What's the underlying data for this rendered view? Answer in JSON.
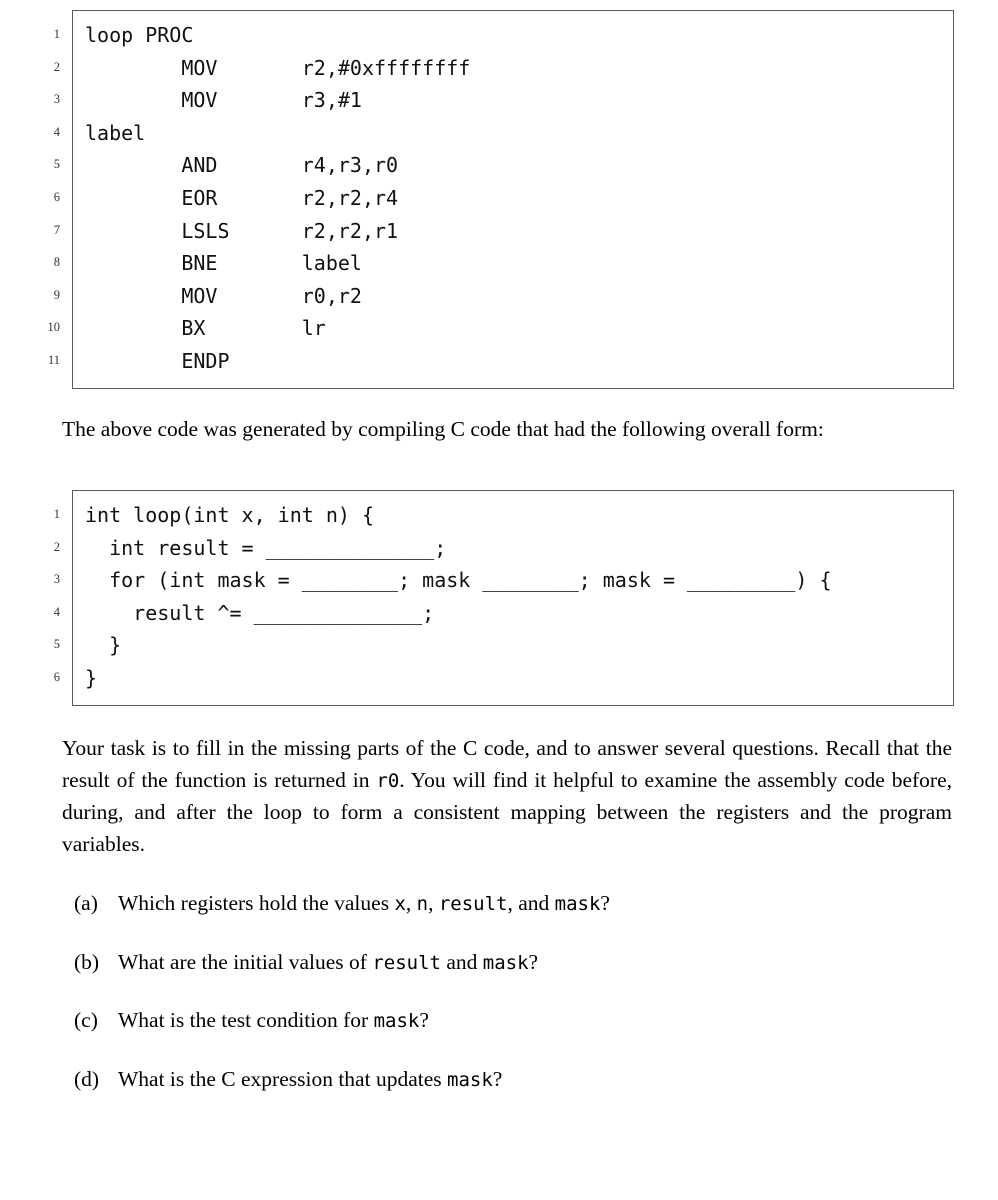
{
  "asm_listing": {
    "name": "arm-assembly-listing",
    "line_numbers": [
      "1",
      "2",
      "3",
      "4",
      "5",
      "6",
      "7",
      "8",
      "9",
      "10",
      "11"
    ],
    "lines": [
      "loop PROC",
      "        MOV       r2,#0xffffffff",
      "        MOV       r3,#1",
      "label",
      "        AND       r4,r3,r0",
      "        EOR       r2,r2,r4",
      "        LSLS      r2,r2,r1",
      "        BNE       label",
      "        MOV       r0,r2",
      "        BX        lr",
      "        ENDP"
    ]
  },
  "intro_paragraph": "The above code was generated by compiling C code that had the following overall form:",
  "c_listing": {
    "name": "c-source-listing",
    "line_numbers": [
      "1",
      "2",
      "3",
      "4",
      "5",
      "6"
    ],
    "lines": [
      "int loop(int x, int n) {",
      "  int result = ______________;",
      "  for (int mask = ________; mask ________; mask = _________) {",
      "    result ^= ______________;",
      "  }",
      "}"
    ]
  },
  "task_paragraph": {
    "part1": "Your task is to fill in the missing parts of the C code, and to answer several questions. Recall that the result of the function is returned in ",
    "mono1": "r0",
    "part2": ". You will find it helpful to examine the assembly code before, during, and after the loop to form a consistent mapping between the registers and the program variables."
  },
  "questions": [
    {
      "label": "(a)",
      "segments": [
        {
          "text": "Which registers hold the values ",
          "mono": false
        },
        {
          "text": "x",
          "mono": true
        },
        {
          "text": ", ",
          "mono": false
        },
        {
          "text": "n",
          "mono": true
        },
        {
          "text": ", ",
          "mono": false
        },
        {
          "text": "result",
          "mono": true
        },
        {
          "text": ", and ",
          "mono": false
        },
        {
          "text": "mask",
          "mono": true
        },
        {
          "text": "?",
          "mono": false
        }
      ],
      "plain": "Which registers hold the values x, n, result, and mask?"
    },
    {
      "label": "(b)",
      "segments": [
        {
          "text": "What are the initial values of ",
          "mono": false
        },
        {
          "text": "result",
          "mono": true
        },
        {
          "text": " and ",
          "mono": false
        },
        {
          "text": "mask",
          "mono": true
        },
        {
          "text": "?",
          "mono": false
        }
      ],
      "plain": "What are the initial values of result and mask?"
    },
    {
      "label": "(c)",
      "segments": [
        {
          "text": "What is the test condition for ",
          "mono": false
        },
        {
          "text": "mask",
          "mono": true
        },
        {
          "text": "?",
          "mono": false
        }
      ],
      "plain": "What is the test condition for mask?"
    },
    {
      "label": "(d)",
      "segments": [
        {
          "text": "What is the C expression that updates ",
          "mono": false
        },
        {
          "text": "mask",
          "mono": true
        },
        {
          "text": "?",
          "mono": false
        }
      ],
      "plain": "What is the C expression that updates mask?"
    }
  ],
  "colors": {
    "frame_border": "#5b5b5b",
    "text": "#000000",
    "line_number": "#33333a",
    "background": "#ffffff"
  }
}
